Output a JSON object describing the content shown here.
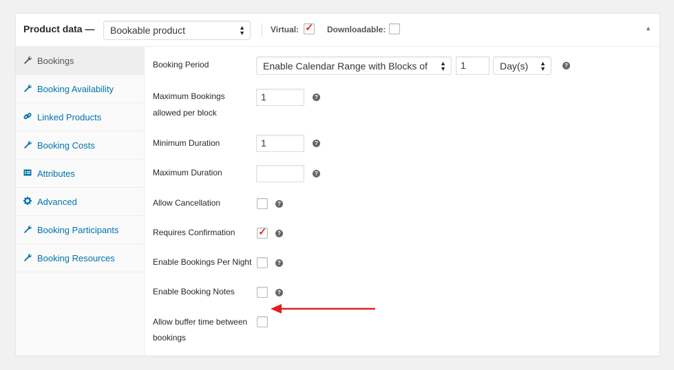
{
  "header": {
    "title": "Product data —",
    "product_type": "Bookable product",
    "virtual_label": "Virtual:",
    "virtual_checked": true,
    "downloadable_label": "Downloadable:",
    "downloadable_checked": false,
    "collapse_icon": "triangle-up-icon"
  },
  "sidebar": {
    "items": [
      {
        "label": "Bookings",
        "icon": "wrench-icon",
        "active": true
      },
      {
        "label": "Booking Availability",
        "icon": "wrench-icon",
        "active": false
      },
      {
        "label": "Linked Products",
        "icon": "link-icon",
        "active": false
      },
      {
        "label": "Booking Costs",
        "icon": "wrench-icon",
        "active": false
      },
      {
        "label": "Attributes",
        "icon": "table-icon",
        "active": false
      },
      {
        "label": "Advanced",
        "icon": "gear-icon",
        "active": false
      },
      {
        "label": "Booking Participants",
        "icon": "wrench-icon",
        "active": false
      },
      {
        "label": "Booking Resources",
        "icon": "wrench-icon",
        "active": false
      }
    ]
  },
  "form": {
    "booking_period": {
      "label": "Booking Period",
      "mode": "Enable Calendar Range with Blocks of",
      "block_count": "1",
      "unit": "Day(s)"
    },
    "max_bookings": {
      "label_line1": "Maximum Bookings",
      "label_line2": "allowed per block",
      "value": "1"
    },
    "min_duration": {
      "label": "Minimum Duration",
      "value": "1"
    },
    "max_duration": {
      "label": "Maximum Duration",
      "value": ""
    },
    "allow_cancellation": {
      "label": "Allow Cancellation",
      "checked": false
    },
    "requires_confirmation": {
      "label": "Requires Confirmation",
      "checked": true
    },
    "per_night": {
      "label": "Enable Bookings Per Night",
      "checked": false
    },
    "booking_notes": {
      "label": "Enable Booking Notes",
      "checked": false
    },
    "buffer_time": {
      "label_line1": "Allow buffer time between",
      "label_line2": "bookings",
      "checked": false
    }
  },
  "help_glyph": "?",
  "accent_colors": {
    "link": "#0073aa",
    "check": "#d63638",
    "annotation_arrow": "#e02020"
  }
}
